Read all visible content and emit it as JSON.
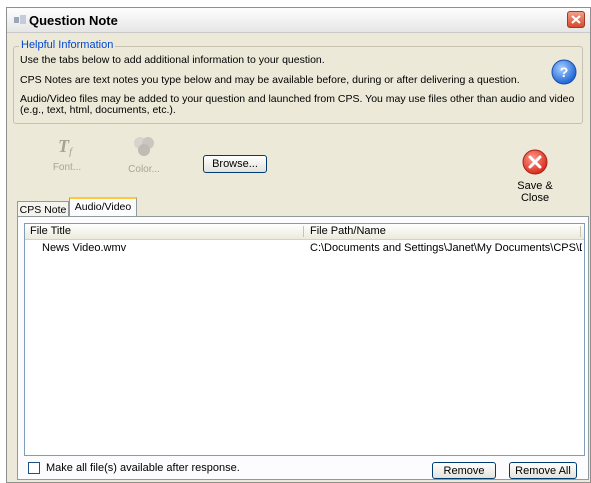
{
  "window": {
    "title": "Question Note"
  },
  "info": {
    "legend": "Helpful Information",
    "lines": [
      "Use the tabs below to add additional information to your question.",
      "CPS Notes are text notes you type below and may be available before, during or after delivering a question.",
      "Audio/Video files may be added to your question and launched from CPS. You may use files other than audio and video",
      "(e.g., text, html, documents, etc.)."
    ]
  },
  "toolbar": {
    "font_label": "Font...",
    "color_label": "Color...",
    "browse_label": "Browse...",
    "save_close_label": "Save & Close"
  },
  "tabs": [
    {
      "label": "CPS Note",
      "active": false
    },
    {
      "label": "Audio/Video",
      "active": true
    }
  ],
  "files": {
    "columns": [
      "File Title",
      "File Path/Name"
    ],
    "rows": [
      {
        "title": "News Video.wmv",
        "path": "C:\\Documents and Settings\\Janet\\My Documents\\CPS\\Dat..."
      }
    ]
  },
  "footer": {
    "checkbox_label": "Make all file(s) available after response.",
    "checkbox_checked": false,
    "remove_label": "Remove",
    "remove_all_label": "Remove All"
  },
  "colors": {
    "accent": "#0046d5",
    "active_tab": "#ffc83c",
    "close": "#d64b2c"
  }
}
